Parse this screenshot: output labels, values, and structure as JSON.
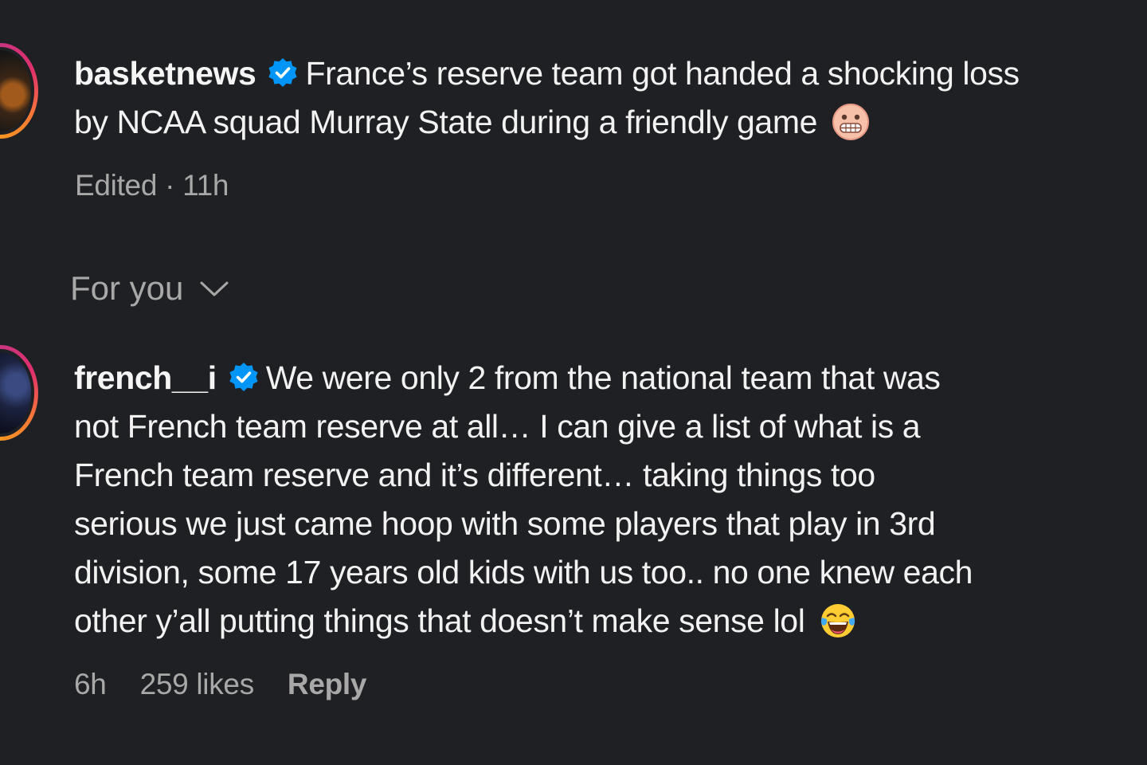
{
  "post": {
    "username": "basketnews",
    "verified": true,
    "caption_line1": "France’s reserve team got handed a shocking loss",
    "caption_line2": "by NCAA squad Murray State during a friendly game",
    "emoji_icon": "grimacing-face-emoji",
    "meta": "Edited · 11h"
  },
  "sort": {
    "label": "For you",
    "icon": "chevron-down-icon"
  },
  "comment": {
    "username": "french__i",
    "verified": true,
    "line1": "We were only 2 from the national team that was",
    "line2": "not French team reserve at all… I can give a list of what is a",
    "line3": "French team reserve and it’s different… taking things too",
    "line4": "serious we just came hoop with some players that play in 3rd",
    "line5": "division, some 17 years old kids with us too.. no one knew each",
    "line6": "other y’all putting things that doesn’t make sense lol",
    "emoji_icon": "tears-of-joy-emoji",
    "time": "6h",
    "likes": "259 likes",
    "reply_label": "Reply"
  },
  "colors": {
    "background": "#1f2024",
    "text": "#f2f2f2",
    "secondary": "#a8a8a8",
    "verified": "#0095f6"
  }
}
